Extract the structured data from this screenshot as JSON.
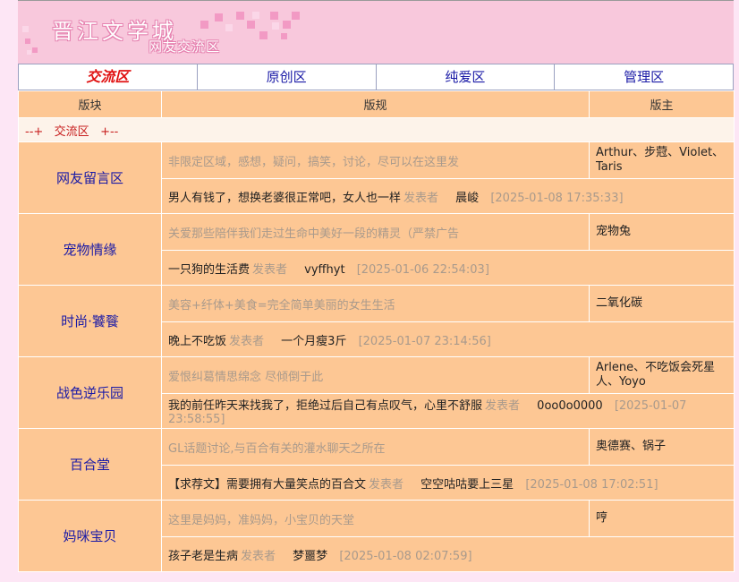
{
  "header": {
    "site_name": "晋江文学城",
    "sub_title": "网友交流区"
  },
  "tabs": [
    {
      "label": "交流区",
      "active": true
    },
    {
      "label": "原创区",
      "active": false
    },
    {
      "label": "纯爱区",
      "active": false
    },
    {
      "label": "管理区",
      "active": false
    }
  ],
  "table": {
    "headers": [
      "版块",
      "版规",
      "版主"
    ],
    "group_label": "--+   交流区   +--",
    "boards": [
      {
        "name": "网友留言区",
        "rule": "非限定区域，感想，疑问，搞笑，讨论，尽可以在这里发",
        "moderators": "Arthur、步蒄、Violet、Taris",
        "latest_title": "男人有钱了，想换老婆很正常吧，女人也一样",
        "latest_by_label": "发表者",
        "latest_author": "晨峻",
        "latest_time": "[2025-01-08 17:35:33]"
      },
      {
        "name": "宠物情缘",
        "rule": "关爱那些陪伴我们走过生命中美好一段的精灵（严禁广告",
        "moderators": "宠物兔",
        "latest_title": "一只狗的生活费",
        "latest_by_label": "发表者",
        "latest_author": "vyffhyt",
        "latest_time": "[2025-01-06 22:54:03]"
      },
      {
        "name": "时尚·饕餮",
        "rule": "美容+纤体+美食=完全简单美丽的女生生活",
        "moderators": "二氧化碳",
        "latest_title": "晚上不吃饭",
        "latest_by_label": "发表者",
        "latest_author": "一个月瘦3斤",
        "latest_time": "[2025-01-07 23:14:56]"
      },
      {
        "name": "战色逆乐园",
        "rule": "爱恨纠葛情思绵念 尽倾倒于此",
        "moderators": "Arlene、不吃饭会死星人、Yoyo",
        "latest_title": "我的前任昨天来找我了，拒绝过后自己有点叹气，心里不舒服",
        "latest_by_label": "发表者",
        "latest_author": "0oo0o0000",
        "latest_time": "[2025-01-07 23:58:55]"
      },
      {
        "name": "百合堂",
        "rule": "GL话题讨论,与百合有关的灌水聊天之所在",
        "moderators": "奥德赛、锅子",
        "latest_title": "【求荐文】需要拥有大量笑点的百合文",
        "latest_by_label": "发表者",
        "latest_author": "空空咕咕要上三星",
        "latest_time": "[2025-01-08 17:02:51]"
      },
      {
        "name": "妈咪宝贝",
        "rule": "这里是妈妈，准妈妈，小宝贝的天堂",
        "moderators": "哼",
        "latest_title": "孩子老是生病",
        "latest_by_label": "发表者",
        "latest_author": "梦噩梦",
        "latest_time": "[2025-01-08 02:07:59]"
      }
    ]
  },
  "colors": {
    "page_bg": "#fde6f5",
    "banner_bg": "#f8c8dc",
    "table_bg": "#fdc794",
    "active_tab": "#e01010",
    "link": "#1a1aa6"
  }
}
